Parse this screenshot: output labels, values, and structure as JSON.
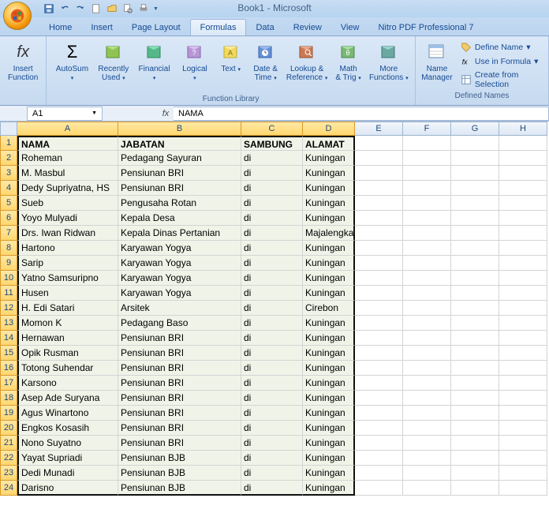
{
  "window_title": "Book1 - Microsoft",
  "qat": [
    "save",
    "undo",
    "redo",
    "new",
    "open",
    "print-preview",
    "print"
  ],
  "ribbon": {
    "tabs": [
      "Home",
      "Insert",
      "Page Layout",
      "Formulas",
      "Data",
      "Review",
      "View",
      "Nitro PDF Professional 7"
    ],
    "active_tab": "Formulas",
    "groups": {
      "fx": {
        "insert_fn": "Insert\nFunction"
      },
      "lib": {
        "label": "Function Library",
        "items": [
          "AutoSum",
          "Recently\nUsed",
          "Financial",
          "Logical",
          "Text",
          "Date &\nTime",
          "Lookup &\nReference",
          "Math\n& Trig",
          "More\nFunctions"
        ]
      },
      "names": {
        "label": "Defined Names",
        "manager": "Name\nManager",
        "define": "Define Name",
        "use": "Use in Formula",
        "create": "Create from Selection"
      }
    }
  },
  "namebox": "A1",
  "formula": "NAMA",
  "columns": [
    "A",
    "B",
    "C",
    "D",
    "E",
    "F",
    "G",
    "H"
  ],
  "chart_data": {
    "type": "table",
    "headers": [
      "NAMA",
      "JABATAN",
      "SAMBUNG",
      "ALAMAT"
    ],
    "rows": [
      [
        "Roheman",
        "Pedagang Sayuran",
        "di",
        "Kuningan"
      ],
      [
        "M. Masbul",
        "Pensiunan BRI",
        "di",
        "Kuningan"
      ],
      [
        "Dedy Supriyatna, HS",
        "Pensiunan BRI",
        "di",
        "Kuningan"
      ],
      [
        "Sueb",
        "Pengusaha Rotan",
        "di",
        "Kuningan"
      ],
      [
        "Yoyo Mulyadi",
        "Kepala Desa",
        "di",
        "Kuningan"
      ],
      [
        "Drs. Iwan Ridwan",
        "Kepala Dinas Pertanian",
        "di",
        "Majalengka"
      ],
      [
        "Hartono",
        "Karyawan Yogya",
        "di",
        "Kuningan"
      ],
      [
        "Sarip",
        "Karyawan Yogya",
        "di",
        "Kuningan"
      ],
      [
        "Yatno Samsuripno",
        "Karyawan Yogya",
        "di",
        "Kuningan"
      ],
      [
        "Husen",
        "Karyawan Yogya",
        "di",
        "Kuningan"
      ],
      [
        "H. Edi Satari",
        "Arsitek",
        "di",
        "Cirebon"
      ],
      [
        "Momon K",
        "Pedagang Baso",
        "di",
        "Kuningan"
      ],
      [
        "Hernawan",
        "Pensiunan BRI",
        "di",
        "Kuningan"
      ],
      [
        "Opik Rusman",
        "Pensiunan BRI",
        "di",
        "Kuningan"
      ],
      [
        "Totong Suhendar",
        "Pensiunan BRI",
        "di",
        "Kuningan"
      ],
      [
        "Karsono",
        "Pensiunan BRI",
        "di",
        "Kuningan"
      ],
      [
        "Asep Ade Suryana",
        "Pensiunan BRI",
        "di",
        "Kuningan"
      ],
      [
        "Agus Winartono",
        "Pensiunan BRI",
        "di",
        "Kuningan"
      ],
      [
        "Engkos Kosasih",
        "Pensiunan BRI",
        "di",
        "Kuningan"
      ],
      [
        "Nono Suyatno",
        "Pensiunan BRI",
        "di",
        "Kuningan"
      ],
      [
        "Yayat Supriadi",
        "Pensiunan BJB",
        "di",
        "Kuningan"
      ],
      [
        "Dedi Munadi",
        "Pensiunan BJB",
        "di",
        "Kuningan"
      ],
      [
        "Darisno",
        "Pensiunan BJB",
        "di",
        "Kuningan"
      ]
    ]
  }
}
